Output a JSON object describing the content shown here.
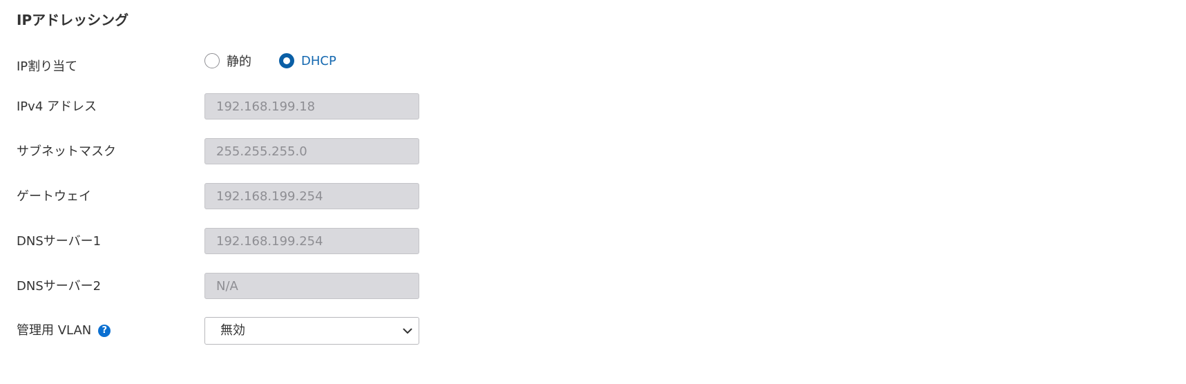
{
  "section": {
    "title": "IPアドレッシング"
  },
  "ip_assignment": {
    "label": "IP割り当て",
    "options": [
      {
        "label": "静的",
        "selected": false
      },
      {
        "label": "DHCP",
        "selected": true
      }
    ]
  },
  "ipv4": {
    "label": "IPv4 アドレス",
    "value": "192.168.199.18"
  },
  "subnet": {
    "label": "サブネットマスク",
    "value": "255.255.255.0"
  },
  "gateway": {
    "label": "ゲートウェイ",
    "value": "192.168.199.254"
  },
  "dns1": {
    "label": "DNSサーバー1",
    "value": "192.168.199.254"
  },
  "dns2": {
    "label": "DNSサーバー2",
    "value": "N/A"
  },
  "mgmt_vlan": {
    "label": "管理用 VLAN",
    "help_icon": "question-circle-icon",
    "selected": "無効"
  },
  "colors": {
    "accent": "#0a5fa6",
    "help_icon": "#0a6fd1",
    "disabled_field_bg": "#d9d9dd"
  }
}
